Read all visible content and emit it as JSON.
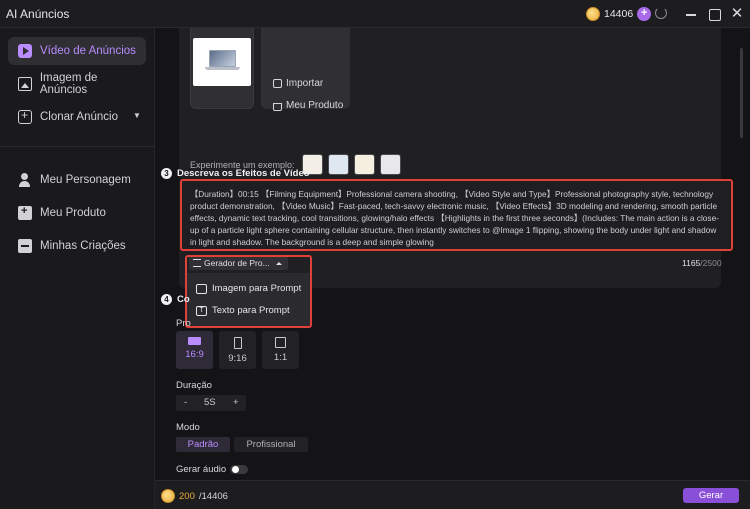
{
  "window": {
    "title": "AI Anúncios"
  },
  "header": {
    "credits": "14406",
    "add_label": "+"
  },
  "sidebar": {
    "items": [
      {
        "label": "Vídeo de Anúncios",
        "icon": "video-icon"
      },
      {
        "label": "Imagem de Anúncios",
        "icon": "image-icon"
      },
      {
        "label": "Clonar Anúncio",
        "icon": "clone-icon"
      },
      {
        "label": "Meu Personagem",
        "icon": "person-icon"
      },
      {
        "label": "Meu Produto",
        "icon": "product-icon"
      },
      {
        "label": "Minhas Criações",
        "icon": "folder-icon"
      }
    ]
  },
  "upload": {
    "import_label": "Importar",
    "product_label": "Meu Produto",
    "examples_label": "Experimente um exemplo:"
  },
  "step3": {
    "number": "3",
    "title": "Descreva os Efeitos de Vídeo",
    "prompt": "【Duration】00:15 【Filming Equipment】Professional camera shooting, 【Video Style and Type】Professional photography style, technology product demonstration, 【Video Music】Fast-paced, tech-savvy electronic music, 【Video Effects】3D modeling and rendering, smooth particle effects, dynamic text tracking, cool transitions, glowing/halo effects 【Highlights in the first three seconds】(Includes: The main action is a close-up of a particle light sphere containing cellular structure, then instantly switches to @Image 1 flipping, showing the body under light and shadow in light and shadow. The background is a deep and simple glowing",
    "generator_label": "Gerador de Pro...",
    "char_count": "1165",
    "char_max": "/2500",
    "menu": {
      "image_to_prompt": "Imagem para Prompt",
      "text_to_prompt": "Texto para Prompt"
    }
  },
  "step4": {
    "number": "4",
    "title": "Co",
    "ratio_label": "Pro",
    "ratios": [
      "16:9",
      "9:16",
      "1:1"
    ],
    "duration_label": "Duração",
    "duration_minus": "-",
    "duration_value": "5S",
    "duration_plus": "+",
    "mode_label": "Modo",
    "modes": [
      "Padrão",
      "Profissional"
    ],
    "audio_label": "Gerar áudio"
  },
  "footer": {
    "used": "200",
    "total": "/14406",
    "generate_label": "Gerar"
  },
  "colors": {
    "accent": "#b98cff",
    "button": "#8a4fd8",
    "highlight_border": "#e0403a",
    "coin": "#e7a93a"
  }
}
